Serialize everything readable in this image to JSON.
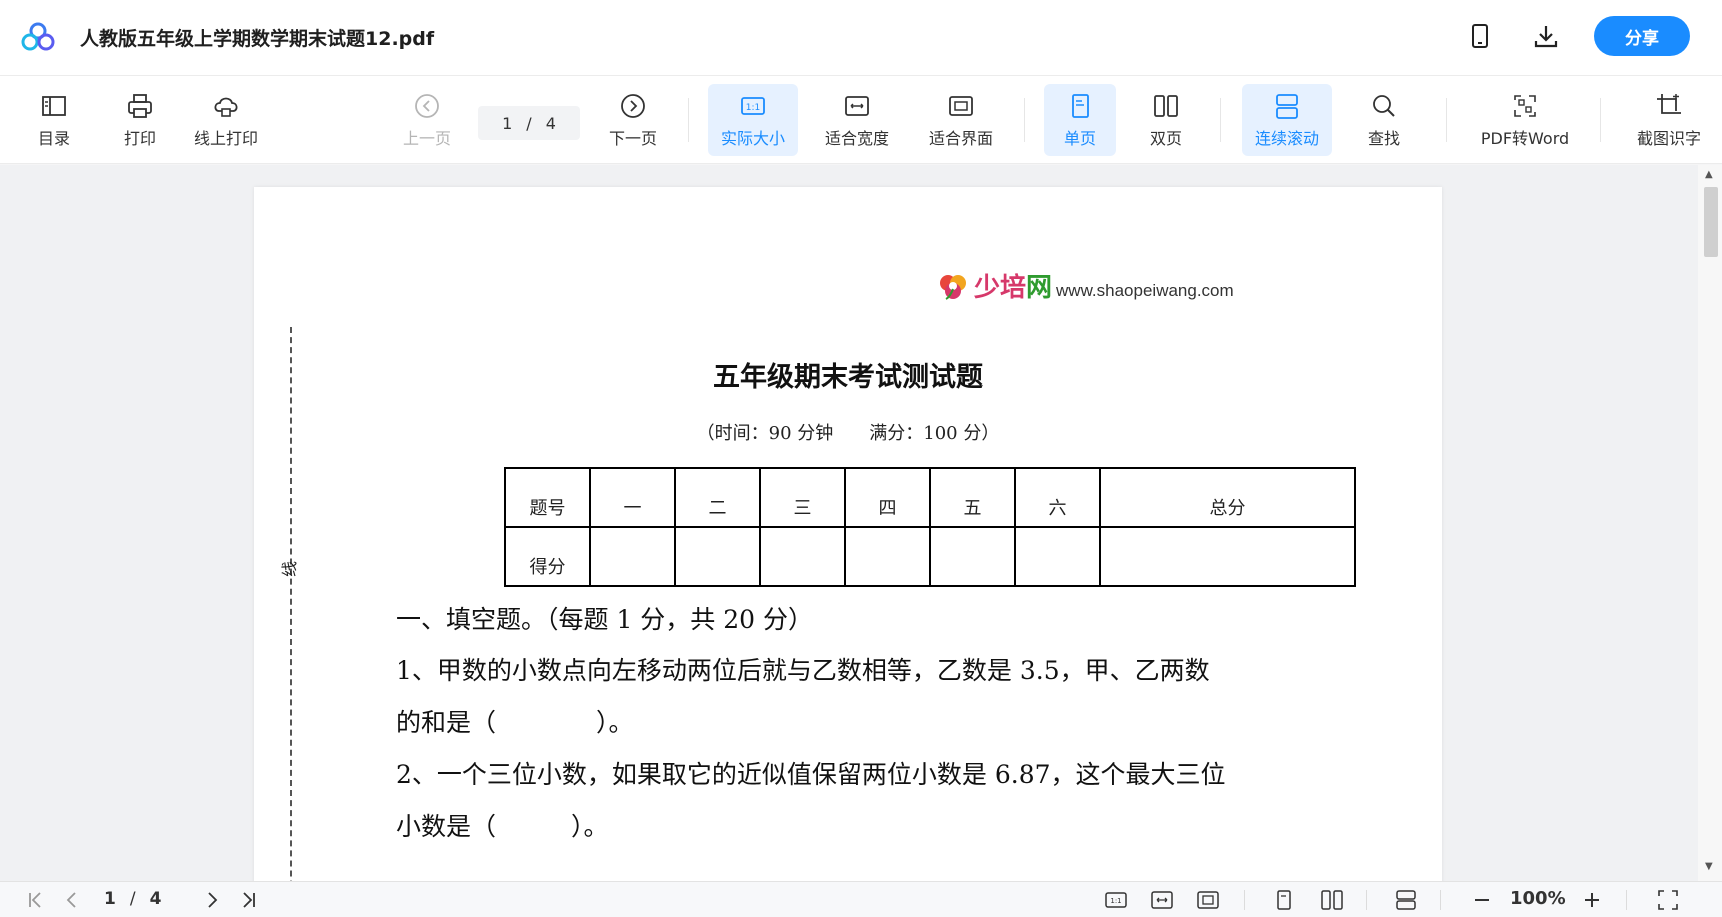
{
  "app": {
    "doc_title": "人教版五年级上学期数学期末试题12.pdf",
    "share_label": "分享",
    "accent_color": "#1a8cff"
  },
  "toolbar": {
    "toc": "目录",
    "print": "打印",
    "online_print": "线上打印",
    "prev": "上一页",
    "current_page": "1",
    "slash": "/",
    "total_pages": "4",
    "next": "下一页",
    "actual_size": "实际大小",
    "fit_width": "适合宽度",
    "fit_page": "适合界面",
    "single": "单页",
    "double": "双页",
    "continuous": "连续滚动",
    "find": "查找",
    "pdf_word": "PDF转Word",
    "ocr": "截图识字"
  },
  "document": {
    "brand_cn_a": "少培",
    "brand_cn_b": "网",
    "brand_url": "www.shaopeiwang.com",
    "title": "五年级期末考试测试题",
    "subtitle": "（时间：90 分钟　　满分：100 分）",
    "binding_label": "线",
    "table": {
      "row1": [
        "题号",
        "一",
        "二",
        "三",
        "四",
        "五",
        "六",
        "总分"
      ],
      "row2": [
        "得分",
        "",
        "",
        "",
        "",
        "",
        "",
        ""
      ]
    },
    "lines": [
      "一、填空题。（每题 1 分，共 20 分）",
      "1、甲数的小数点向左移动两位后就与乙数相等，乙数是 3.5，甲、乙两数",
      "的和是（　　　　）。",
      "2、一个三位小数，如果取它的近似值保留两位小数是 6.87，这个最大三位",
      "小数是（　　　）。"
    ]
  },
  "statusbar": {
    "current_page": "1",
    "slash": "/",
    "total_pages": "4",
    "zoom": "100%"
  }
}
